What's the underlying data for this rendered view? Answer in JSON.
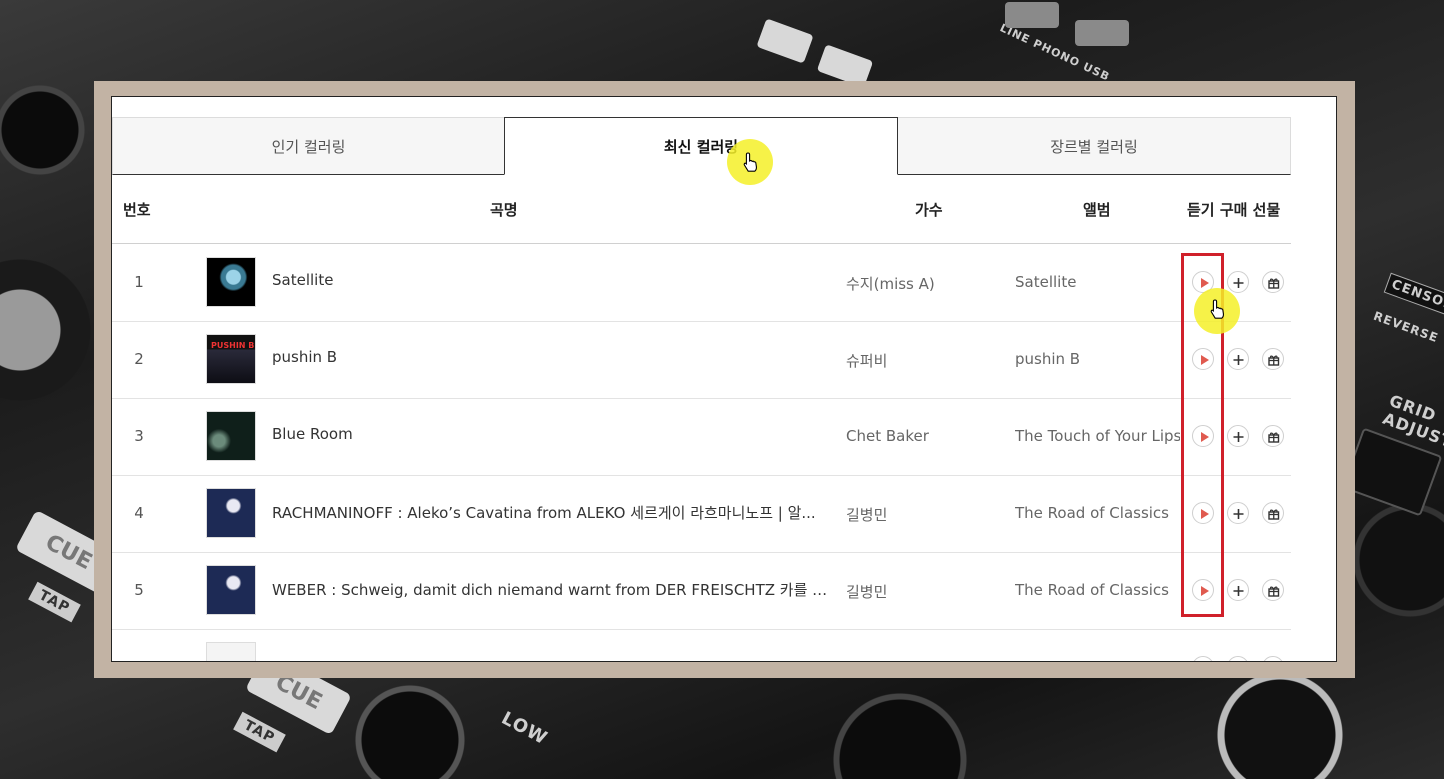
{
  "tabs": [
    {
      "label": "인기 컬러링",
      "active": false
    },
    {
      "label": "최신 컬러링",
      "active": true
    },
    {
      "label": "장르별 컬러링",
      "active": false
    }
  ],
  "headers": {
    "number": "번호",
    "title": "곡명",
    "artist": "가수",
    "album": "앨범",
    "actions": "듣기 구매 선물"
  },
  "songs": [
    {
      "number": "1",
      "title": "Satellite",
      "artist": "수지(miss A)",
      "album": "Satellite"
    },
    {
      "number": "2",
      "title": "pushin B",
      "artist": "슈퍼비",
      "album": "pushin B",
      "cover_text": "PUSHIN B"
    },
    {
      "number": "3",
      "title": "Blue Room",
      "artist": "Chet Baker",
      "album": "The Touch of Your Lips"
    },
    {
      "number": "4",
      "title": "RACHMANINOFF : Aleko’s Cavatina from ALEKO 세르게이 라흐마니노프 | 알...",
      "artist": "길병민",
      "album": "The Road of Classics"
    },
    {
      "number": "5",
      "title": "WEBER : Schweig, damit dich niemand warnt from DER FREISCHTZ 카를 마리...",
      "artist": "길병민",
      "album": "The Road of Classics"
    }
  ],
  "colors": {
    "frame": "#c2b3a4",
    "highlight_box": "#d0202a",
    "play_icon": "#e05a4f",
    "cursor_highlight": "#f5f028"
  },
  "icons": {
    "play": "play-icon",
    "add": "plus-icon",
    "gift": "gift-icon"
  },
  "background": {
    "cue_label": "CUE",
    "tap_label": "TAP",
    "low_label": "LOW",
    "line_label": "LINE PHONO USB",
    "grid_label": "GRID ADJUST",
    "censor_label": "CENSOR",
    "reverse_label": "REVERSE"
  }
}
